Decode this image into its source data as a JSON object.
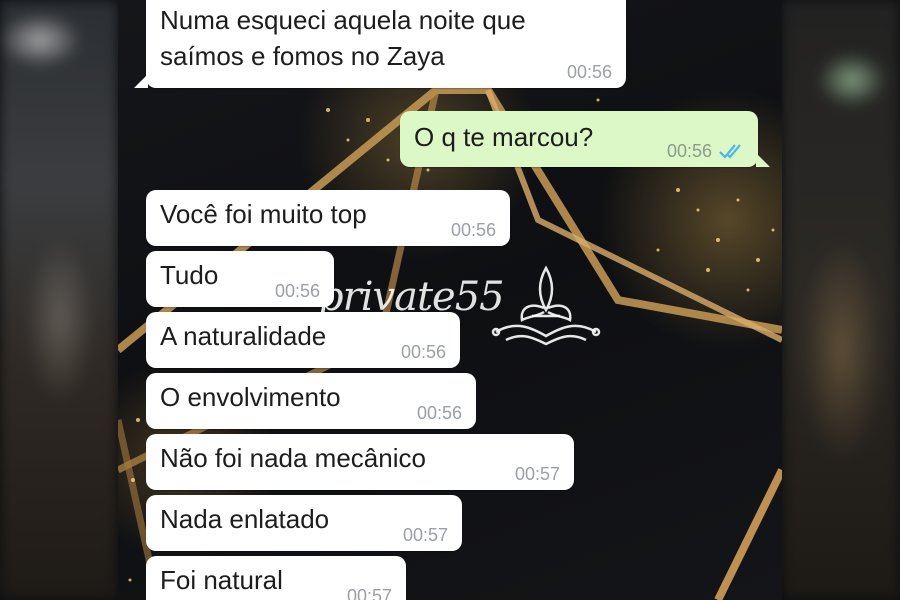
{
  "watermark": {
    "text": "private55",
    "icon": "fleur-de-lis-icon"
  },
  "messages": [
    {
      "direction": "in",
      "lines": [
        "Numa esqueci aquela noite que",
        "saímos e fomos no Zaya"
      ],
      "time": "00:56"
    },
    {
      "direction": "out",
      "text": "O q te marcou?",
      "time": "00:56",
      "status": "read",
      "status_icon": "double-check-icon"
    },
    {
      "direction": "in",
      "text": "Você foi muito top",
      "time": "00:56"
    },
    {
      "direction": "in",
      "text": "Tudo",
      "time": "00:56"
    },
    {
      "direction": "in",
      "text": "A naturalidade",
      "time": "00:56"
    },
    {
      "direction": "in",
      "text": "O envolvimento",
      "time": "00:56"
    },
    {
      "direction": "in",
      "text": "Não foi nada mecânico",
      "time": "00:57"
    },
    {
      "direction": "in",
      "text": "Nada enlatado",
      "time": "00:57"
    },
    {
      "direction": "in",
      "text": "Foi natural",
      "time": "00:57"
    }
  ],
  "colors": {
    "incoming": "#ffffff",
    "outgoing": "#dcf8c6",
    "read_ticks": "#4fb6ec",
    "timestamp": "#9aa0a6"
  }
}
